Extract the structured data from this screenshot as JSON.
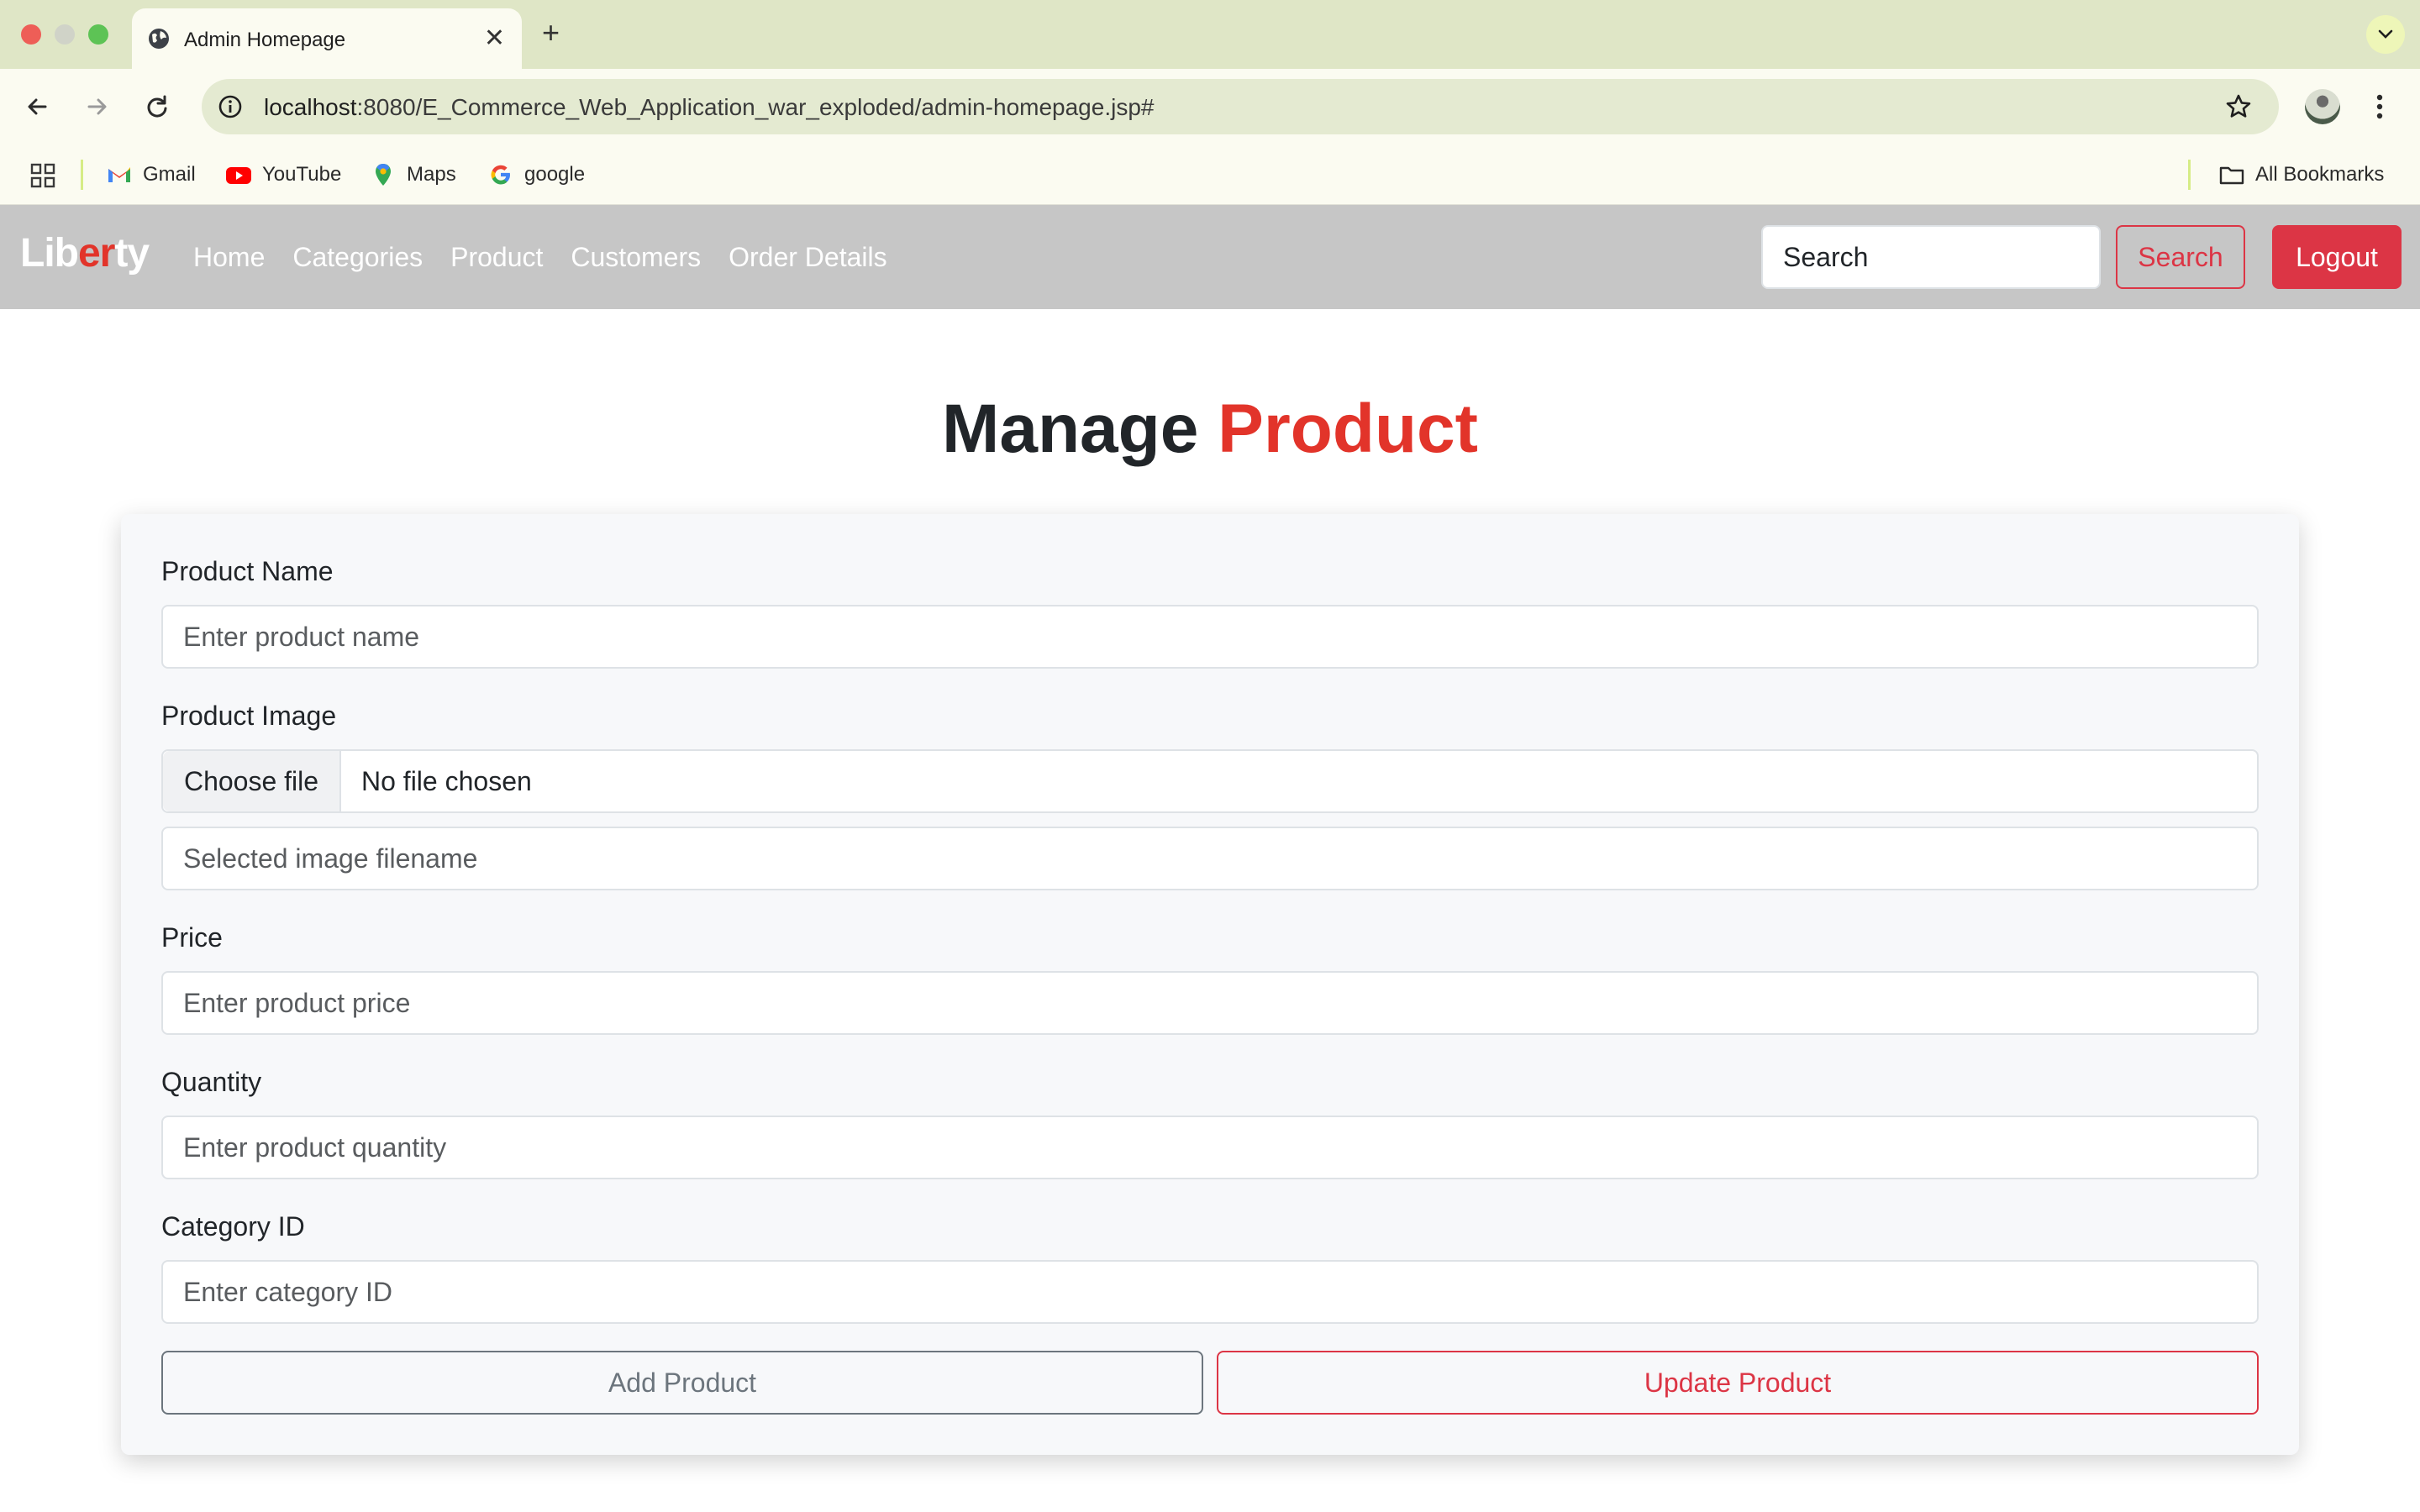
{
  "browser": {
    "tab_title": "Admin Homepage",
    "new_tab_glyph": "+",
    "close_glyph": "✕",
    "url_host": "localhost",
    "url_rest": ":8080/E_Commerce_Web_Application_war_exploded/admin-homepage.jsp#",
    "bookmarks": [
      {
        "label": "Gmail",
        "icon": "gmail-icon"
      },
      {
        "label": "YouTube",
        "icon": "youtube-icon"
      },
      {
        "label": "Maps",
        "icon": "maps-icon"
      },
      {
        "label": "google",
        "icon": "google-icon"
      }
    ],
    "all_bookmarks": "All Bookmarks"
  },
  "navbar": {
    "brand_part1": "Lib",
    "brand_accent": "er",
    "brand_part2": "ty",
    "links": [
      "Home",
      "Categories",
      "Product",
      "Customers",
      "Order Details"
    ],
    "search_placeholder": "Search",
    "search_button": "Search",
    "logout_button": "Logout"
  },
  "page": {
    "title_main": "Manage",
    "title_accent": "Product"
  },
  "form": {
    "product_name_label": "Product Name",
    "product_name_placeholder": "Enter product name",
    "product_image_label": "Product Image",
    "choose_file_button": "Choose file",
    "file_status": "No file chosen",
    "image_filename_placeholder": "Selected image filename",
    "price_label": "Price",
    "price_placeholder": "Enter product price",
    "quantity_label": "Quantity",
    "quantity_placeholder": "Enter product quantity",
    "category_label": "Category ID",
    "category_placeholder": "Enter category ID",
    "add_button": "Add Product",
    "update_button": "Update Product"
  },
  "colors": {
    "accent_red": "#e2342a",
    "danger": "#dc3545",
    "navbar_bg": "#c6c6c6",
    "secondary": "#6c757d"
  }
}
